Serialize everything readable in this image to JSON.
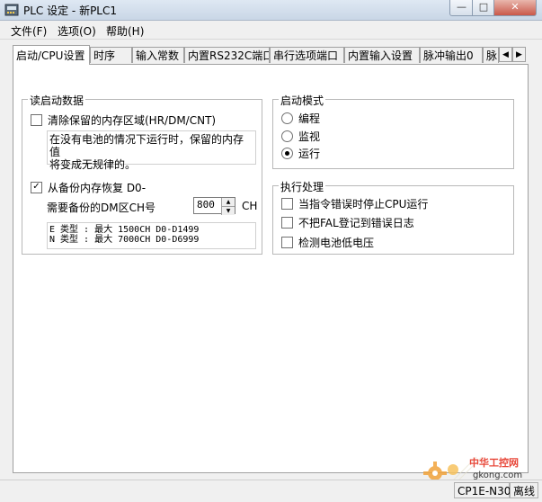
{
  "window": {
    "title": "PLC 设定 - 新PLC1",
    "minimize_glyph": "—",
    "maximize_glyph": "□",
    "close_glyph": "✕"
  },
  "menu": {
    "file": "文件(F)",
    "options": "选项(O)",
    "help": "帮助(H)"
  },
  "tabs": [
    {
      "label": "启动/CPU设置",
      "active": true
    },
    {
      "label": "时序"
    },
    {
      "label": "输入常数"
    },
    {
      "label": "内置RS232C端口"
    },
    {
      "label": "串行选项端口"
    },
    {
      "label": "内置输入设置"
    },
    {
      "label": "脉冲输出0"
    },
    {
      "label": "脉"
    }
  ],
  "tab_scroll": {
    "left": "◀",
    "right": "▶"
  },
  "read_startup": {
    "title": "读启动数据",
    "clear_retained_label": "清除保留的内存区域(HR/DM/CNT)",
    "clear_retained_checked": false,
    "clear_retained_desc_line1": "在没有电池的情况下运行时，保留的内存值",
    "clear_retained_desc_line2": "将变成无规律的。",
    "restore_backup_label": "从备份内存恢复 D0-",
    "restore_backup_checked": true,
    "dm_count_label": "需要备份的DM区CH号",
    "dm_count_value": "800",
    "dm_count_unit": "CH",
    "type_e_line": "E 类型 : 最大 1500CH  D0-D1499",
    "type_n_line": "N 类型 : 最大 7000CH  D0-D6999"
  },
  "startup_mode": {
    "title": "启动模式",
    "options": [
      {
        "label": "编程",
        "checked": false
      },
      {
        "label": "监视",
        "checked": false
      },
      {
        "label": "运行",
        "checked": true
      }
    ]
  },
  "execution": {
    "title": "执行处理",
    "options": [
      {
        "label": "当指令错误时停止CPU运行",
        "checked": false
      },
      {
        "label": "不把FAL登记到错误日志",
        "checked": false
      },
      {
        "label": "检测电池低电压",
        "checked": false
      }
    ]
  },
  "status": {
    "model": "CP1E-N30",
    "connection": "离线"
  },
  "watermark": {
    "line1": "中华工控网",
    "line2": "gkong.com"
  },
  "colors": {
    "titlebar": "#c9d6e6",
    "close_button": "#c9584a",
    "panel": "#ffffff"
  }
}
